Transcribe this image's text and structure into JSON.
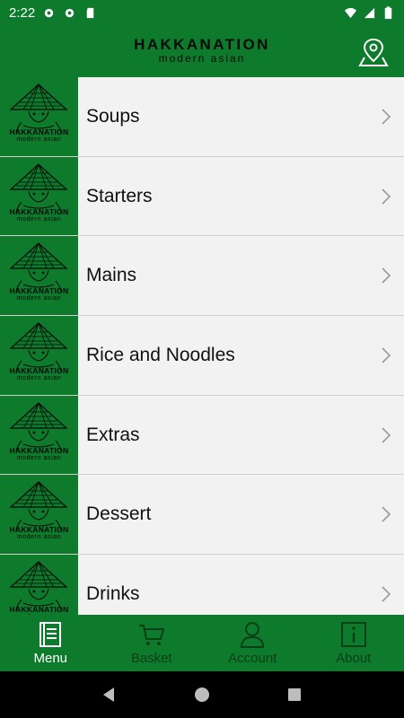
{
  "status_bar": {
    "time": "2:22"
  },
  "header": {
    "brand_name": "HAKKANATION",
    "brand_tagline": "modern asian"
  },
  "thumbnail": {
    "brand_name": "HAKKANATION",
    "brand_tagline": "modern asian"
  },
  "menu": {
    "items": [
      {
        "label": "Soups"
      },
      {
        "label": "Starters"
      },
      {
        "label": "Mains"
      },
      {
        "label": "Rice and Noodles"
      },
      {
        "label": "Extras"
      },
      {
        "label": "Dessert"
      },
      {
        "label": "Drinks"
      }
    ]
  },
  "tabs": [
    {
      "label": "Menu",
      "icon": "menu-book-icon",
      "active": true
    },
    {
      "label": "Basket",
      "icon": "cart-icon",
      "active": false
    },
    {
      "label": "Account",
      "icon": "person-icon",
      "active": false
    },
    {
      "label": "About",
      "icon": "info-icon",
      "active": false
    }
  ],
  "colors": {
    "primary": "#0d7a2c",
    "list_bg": "#f2f2f2",
    "inactive_tab": "#0a3f18"
  }
}
